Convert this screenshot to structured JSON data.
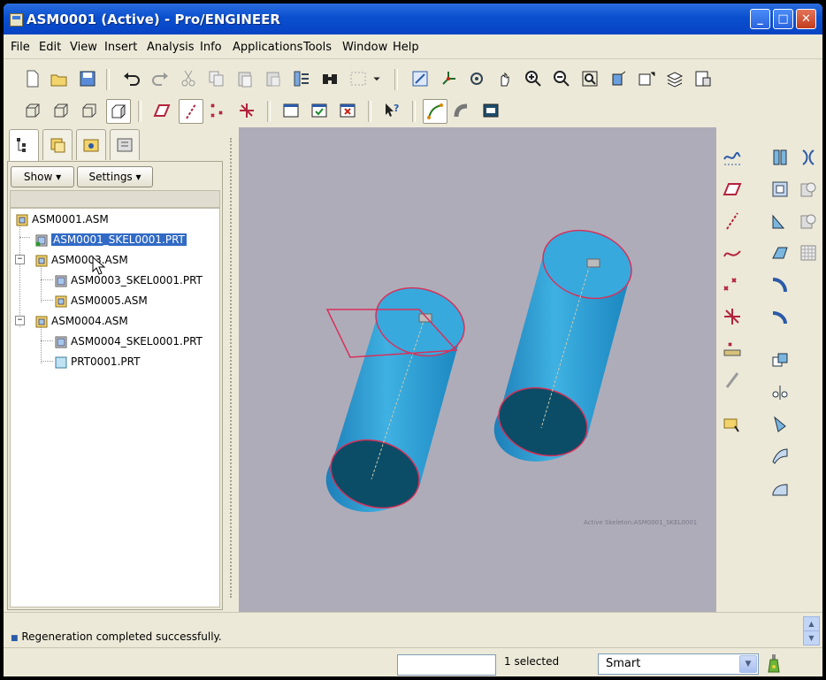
{
  "window": {
    "title": "ASM0001 (Active) - Pro/ENGINEER"
  },
  "menubar": {
    "items": [
      "File",
      "Edit",
      "View",
      "Insert",
      "Analysis",
      "Info",
      "Applications",
      "Tools",
      "Window",
      "Help"
    ]
  },
  "toolbar_row1": [
    "new-icon",
    "open-icon",
    "save-icon",
    "undo-icon",
    "redo-icon",
    "cut-icon",
    "copy-icon",
    "paste-icon",
    "paste-special-icon",
    "regenerate-icon",
    "find-icon",
    "select-box-icon",
    "dropdown-icon",
    "repaint-icon",
    "spin-center-icon",
    "orient-mode-icon",
    "pan-icon",
    "zoom-in-icon",
    "zoom-out-icon",
    "refit-icon",
    "reorient-icon",
    "saved-views-icon",
    "layers-icon",
    "view-manager-icon"
  ],
  "toolbar_row2": [
    "wireframe-icon",
    "hidden-line-icon",
    "no-hidden-icon",
    "shading-icon",
    "datum-planes-icon",
    "datum-axes-icon",
    "datum-points-icon",
    "coordinate-systems-icon",
    "window-icon",
    "activate-window-icon",
    "close-window-icon",
    "context-help-icon",
    "sketch-icon",
    "pipe-icon",
    "model-tree-toggle-icon"
  ],
  "navigator": {
    "tabs": [
      "model-tree-tab-icon",
      "folder-browser-tab-icon",
      "favorites-tab-icon",
      "connections-tab-icon"
    ],
    "show_label": "Show ▾",
    "settings_label": "Settings ▾",
    "tree": [
      {
        "label": "ASM0001.ASM",
        "type": "asm",
        "level": 0,
        "selected": false
      },
      {
        "label": "ASM0001_SKEL0001.PRT",
        "type": "skel",
        "level": 1,
        "selected": true
      },
      {
        "label": "ASM0003.ASM",
        "type": "asm",
        "level": 1,
        "selected": false,
        "expander": "−"
      },
      {
        "label": "ASM0003_SKEL0001.PRT",
        "type": "skel",
        "level": 2,
        "selected": false
      },
      {
        "label": "ASM0005.ASM",
        "type": "asm",
        "level": 2,
        "selected": false
      },
      {
        "label": "ASM0004.ASM",
        "type": "asm",
        "level": 1,
        "selected": false,
        "expander": "−"
      },
      {
        "label": "ASM0004_SKEL0001.PRT",
        "type": "skel",
        "level": 2,
        "selected": false
      },
      {
        "label": "PRT0001.PRT",
        "type": "prt",
        "level": 2,
        "selected": false
      }
    ]
  },
  "viewport": {
    "active_skeleton_text": "Active Skeleton:ASM0001_SKEL0001"
  },
  "right_toolbar": [
    "sketched-curve-icon",
    "datum-plane-icon",
    "datum-axis-icon",
    "curve-icon",
    "datum-point-icon",
    "csys-icon",
    "analysis-feature-icon",
    "placement-icon",
    "extrude-icon",
    "revolve-icon",
    "shell-icon",
    "draft-icon",
    "rib-icon",
    "hole-icon",
    "round-icon",
    "chamfer-icon",
    "copy-feature-icon",
    "mirror-icon",
    "merge-icon",
    "trim-icon",
    "offset-icon",
    "solidify-icon"
  ],
  "message": {
    "text": "Regeneration completed successfully."
  },
  "status": {
    "selected_text": "1 selected",
    "filter_value": "Smart"
  },
  "colors": {
    "titlebar": "#0a4fcf",
    "viewport_bg": "#afacb9",
    "cylinder": "#2d9ed4",
    "cylinder_dark": "#0a4a63",
    "edge": "#d8305a",
    "selection": "#316ac5"
  }
}
